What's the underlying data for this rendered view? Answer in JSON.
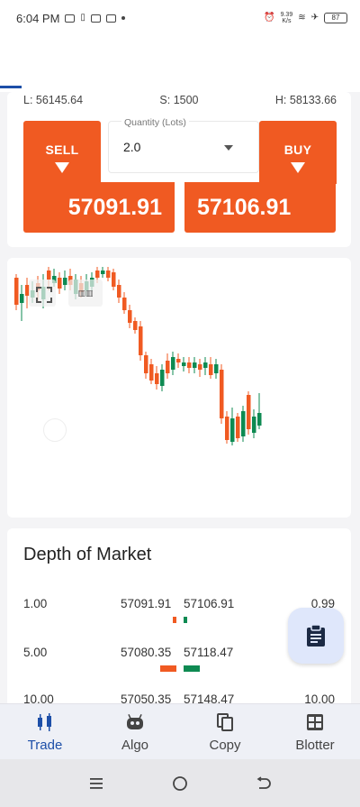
{
  "status_bar": {
    "time": "6:04 PM",
    "net_speed": "9.39",
    "net_unit": "K/s",
    "battery": "87"
  },
  "stats": {
    "low": "L: 56145.64",
    "spread": "S: 1500",
    "high": "H: 58133.66"
  },
  "order": {
    "quantity_label": "Quantity (Lots)",
    "quantity_value": "2.0",
    "sell_label": "SELL",
    "buy_label": "BUY",
    "sell_price": "57091.91",
    "buy_price": "57106.91"
  },
  "chart_data": {
    "type": "candlestick",
    "colors": {
      "up": "#0e8a52",
      "down": "#f05a22"
    }
  },
  "depth": {
    "title": "Depth of Market",
    "rows": [
      {
        "bid_volume": "1.00",
        "bid": "57091.91",
        "ask": "57106.91",
        "ask_volume": "0.99",
        "bid_bar": 0.2,
        "ask_bar": 0.2
      },
      {
        "bid_volume": "5.00",
        "bid": "57080.35",
        "ask": "57118.47",
        "ask_volume": "",
        "bid_bar": 1.0,
        "ask_bar": 1.0
      },
      {
        "bid_volume": "10.00",
        "bid": "57050.35",
        "ask": "57148.47",
        "ask_volume": "10.00",
        "bid_bar": 0,
        "ask_bar": 0
      }
    ]
  },
  "nav": {
    "items": [
      {
        "label": "Trade",
        "icon": "candlestick-icon",
        "active": true
      },
      {
        "label": "Algo",
        "icon": "robot-icon",
        "active": false
      },
      {
        "label": "Copy",
        "icon": "copy-icon",
        "active": false
      },
      {
        "label": "Blotter",
        "icon": "grid-icon",
        "active": false
      }
    ]
  },
  "theme": {
    "accent": "#1d4fa8",
    "sell": "#f05a22",
    "buy": "#0e8a52"
  }
}
